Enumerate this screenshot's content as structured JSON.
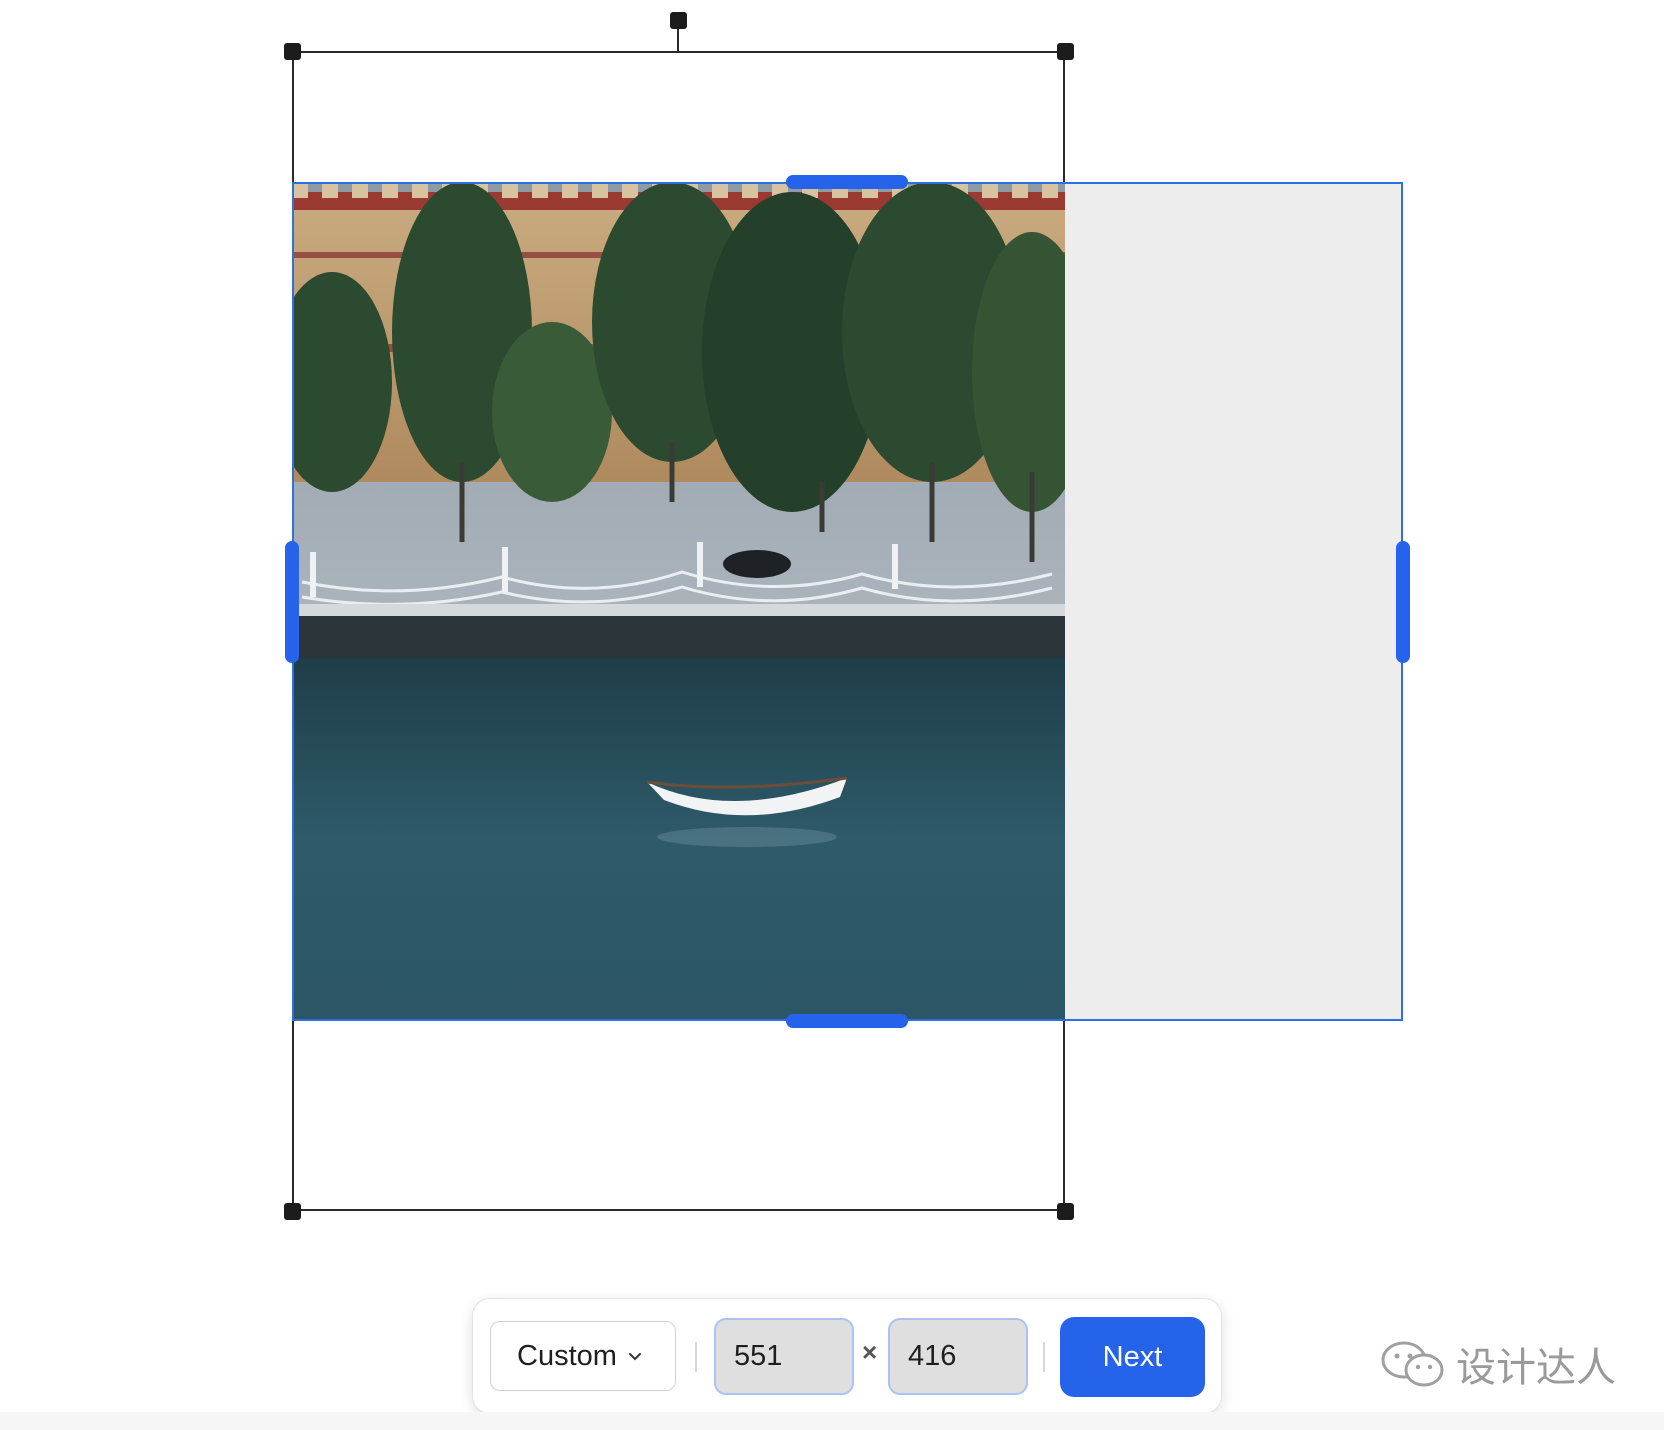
{
  "toolbar": {
    "preset_label": "Custom",
    "width_value": "551",
    "height_value": "416",
    "times_symbol": "×",
    "next_label": "Next"
  },
  "watermark": {
    "text": "设计达人",
    "icon": "wechat-icon"
  },
  "colors": {
    "accent": "#2563eb",
    "frame": "#2a2a2a",
    "extend_fill": "#ededed"
  }
}
